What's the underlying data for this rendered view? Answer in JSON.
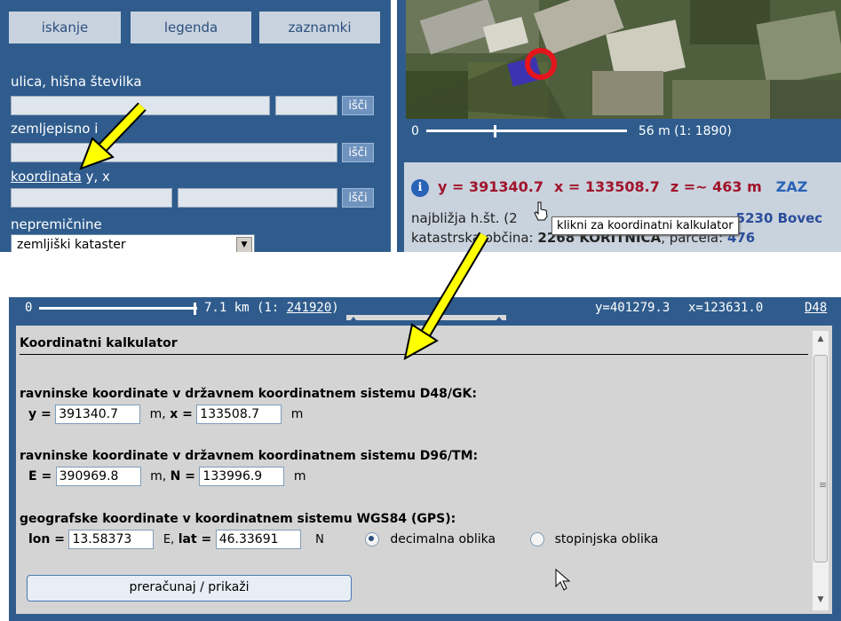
{
  "tabs": [
    "iskanje",
    "legenda",
    "zaznamki"
  ],
  "search": {
    "street_label": "ulica, hišna številka",
    "geo_label": "zemljepisno i",
    "coord_link": "koordinata",
    "coord_suffix": " y, x",
    "property_label": "nepremičnine",
    "property_select": "zemljiški kataster",
    "search_button": "išči"
  },
  "map_panel": {
    "scale_start": "0",
    "scale_text": "56 m (1: ",
    "scale_value": "1890",
    "scale_end": ")"
  },
  "info": {
    "y": "y = 391340.7",
    "x": "x = 133508.7",
    "z": "z =~ 463 m",
    "extra": "ZAZ",
    "nearest_prefix": "najbližja h.št. (2",
    "nearest_tail": "5230 Bovec",
    "cadastral_text": "katastrska občina: ",
    "cadastral_value": "2268 KORITNICA",
    "parcel_label": ", parcela: ",
    "parcel_value": "476",
    "tooltip": "klikni za koordinatni kalkulator"
  },
  "bottom_bar": {
    "scale_start": "0",
    "scale_text": "7.1 km (1: ",
    "scale_value": "241920",
    "scale_end": ")",
    "y": "y=401279.3",
    "x": "x=123631.0",
    "system": "D48"
  },
  "calculator": {
    "title": "Koordinatni kalkulator",
    "d48_title": "ravninske koordinate v državnem koordinatnem sistemu D48/GK:",
    "d48_y_label": "y =",
    "d48_y": "391340.7",
    "d48_sep": "m,",
    "d48_x_label": "x =",
    "d48_x": "133508.7",
    "d48_unit": "m",
    "d96_title": "ravninske koordinate v državnem koordinatnem sistemu D96/TM:",
    "d96_e_label": "E =",
    "d96_e": "390969.8",
    "d96_sep": "m,",
    "d96_n_label": "N =",
    "d96_n": "133996.9",
    "d96_unit": "m",
    "wgs_title": "geografske koordinate v koordinatnem sistemu WGS84 (GPS):",
    "lon_label": "lon =",
    "lon": "13.58373",
    "lon_sep": "E,",
    "lat_label": "lat =",
    "lat": "46.33691",
    "lat_unit": "N",
    "radio_decimal": "decimalna oblika",
    "radio_dms": "stopinjska oblika",
    "selected_format": "decimalna oblika",
    "button": "preračunaj / prikaži"
  },
  "colors": {
    "panel_blue": "#2f5c8d",
    "arrow_yellow": "#ffff00",
    "info_red": "#a0142b"
  }
}
